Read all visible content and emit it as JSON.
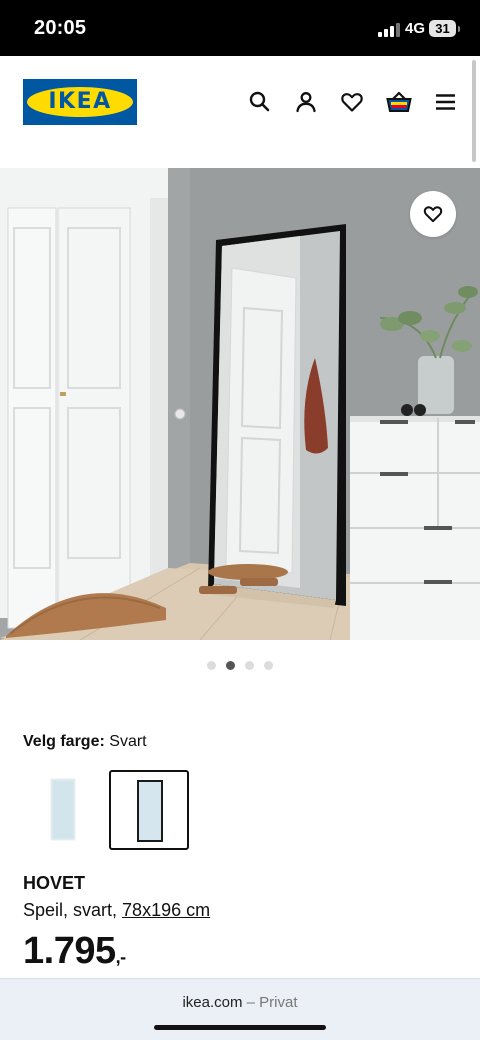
{
  "status_bar": {
    "time": "20:05",
    "network": "4G",
    "battery": "31"
  },
  "header": {
    "logo_text": "IKEA",
    "icons": [
      "search-icon",
      "account-icon",
      "heart-icon",
      "basket-icon",
      "menu-icon"
    ]
  },
  "gallery": {
    "dots_count": 4,
    "active_index": 1
  },
  "color_select": {
    "label": "Velg farge:",
    "value": "Svart"
  },
  "product": {
    "name": "HOVET",
    "desc_prefix": "Speil, svart, ",
    "size": "78x196 cm",
    "price": "1.795",
    "price_suffix": ",-"
  },
  "browser": {
    "domain": "ikea.com",
    "mode": "– Privat"
  },
  "colors": {
    "ikea_blue": "#0058a3",
    "ikea_yellow": "#ffdb00",
    "wall": "#9fa2a3",
    "floor": "#d9c9b3"
  }
}
